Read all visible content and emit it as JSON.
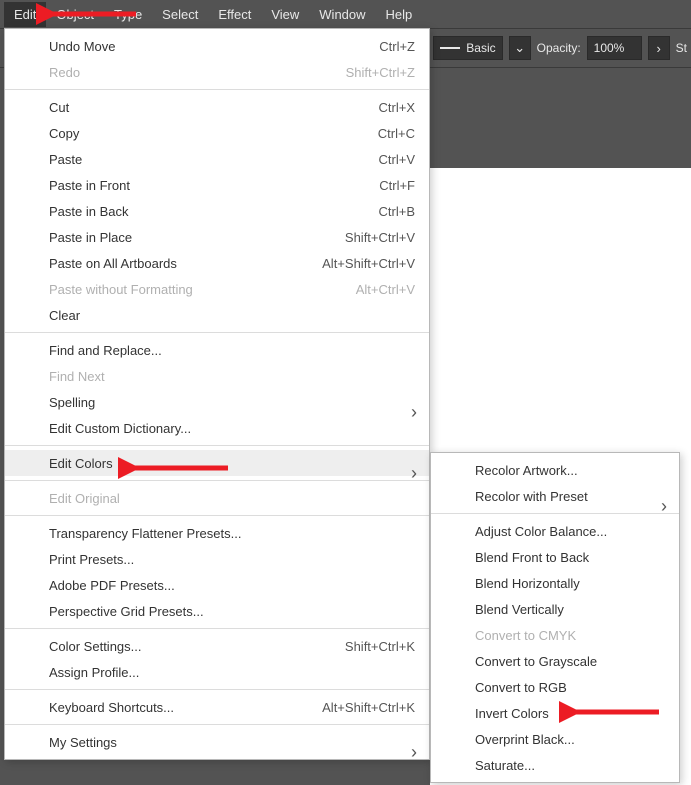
{
  "menubar": [
    "Edit",
    "Object",
    "Type",
    "Select",
    "Effect",
    "View",
    "Window",
    "Help"
  ],
  "toolbar": {
    "style_label": "Basic",
    "opacity_label": "Opacity:",
    "opacity_value": "100%",
    "st_label": "St"
  },
  "edit_menu": [
    {
      "label": "Undo Move",
      "shortcut": "Ctrl+Z"
    },
    {
      "label": "Redo",
      "shortcut": "Shift+Ctrl+Z",
      "disabled": true
    },
    {
      "sep": true
    },
    {
      "label": "Cut",
      "shortcut": "Ctrl+X"
    },
    {
      "label": "Copy",
      "shortcut": "Ctrl+C"
    },
    {
      "label": "Paste",
      "shortcut": "Ctrl+V"
    },
    {
      "label": "Paste in Front",
      "shortcut": "Ctrl+F"
    },
    {
      "label": "Paste in Back",
      "shortcut": "Ctrl+B"
    },
    {
      "label": "Paste in Place",
      "shortcut": "Shift+Ctrl+V"
    },
    {
      "label": "Paste on All Artboards",
      "shortcut": "Alt+Shift+Ctrl+V"
    },
    {
      "label": "Paste without Formatting",
      "shortcut": "Alt+Ctrl+V",
      "disabled": true
    },
    {
      "label": "Clear"
    },
    {
      "sep": true
    },
    {
      "label": "Find and Replace..."
    },
    {
      "label": "Find Next",
      "disabled": true
    },
    {
      "label": "Spelling",
      "submenu": true
    },
    {
      "label": "Edit Custom Dictionary..."
    },
    {
      "sep": true
    },
    {
      "label": "Edit Colors",
      "submenu": true,
      "hover": true
    },
    {
      "sep": true
    },
    {
      "label": "Edit Original",
      "disabled": true
    },
    {
      "sep": true
    },
    {
      "label": "Transparency Flattener Presets..."
    },
    {
      "label": "Print Presets..."
    },
    {
      "label": "Adobe PDF Presets..."
    },
    {
      "label": "Perspective Grid Presets..."
    },
    {
      "sep": true
    },
    {
      "label": "Color Settings...",
      "shortcut": "Shift+Ctrl+K"
    },
    {
      "label": "Assign Profile..."
    },
    {
      "sep": true
    },
    {
      "label": "Keyboard Shortcuts...",
      "shortcut": "Alt+Shift+Ctrl+K"
    },
    {
      "sep": true
    },
    {
      "label": "My Settings",
      "submenu": true
    }
  ],
  "colors_submenu": [
    {
      "label": "Recolor Artwork..."
    },
    {
      "label": "Recolor with Preset",
      "submenu": true
    },
    {
      "sep": true
    },
    {
      "label": "Adjust Color Balance..."
    },
    {
      "label": "Blend Front to Back"
    },
    {
      "label": "Blend Horizontally"
    },
    {
      "label": "Blend Vertically"
    },
    {
      "label": "Convert to CMYK",
      "disabled": true
    },
    {
      "label": "Convert to Grayscale"
    },
    {
      "label": "Convert to RGB"
    },
    {
      "label": "Invert Colors"
    },
    {
      "label": "Overprint Black..."
    },
    {
      "label": "Saturate..."
    }
  ]
}
